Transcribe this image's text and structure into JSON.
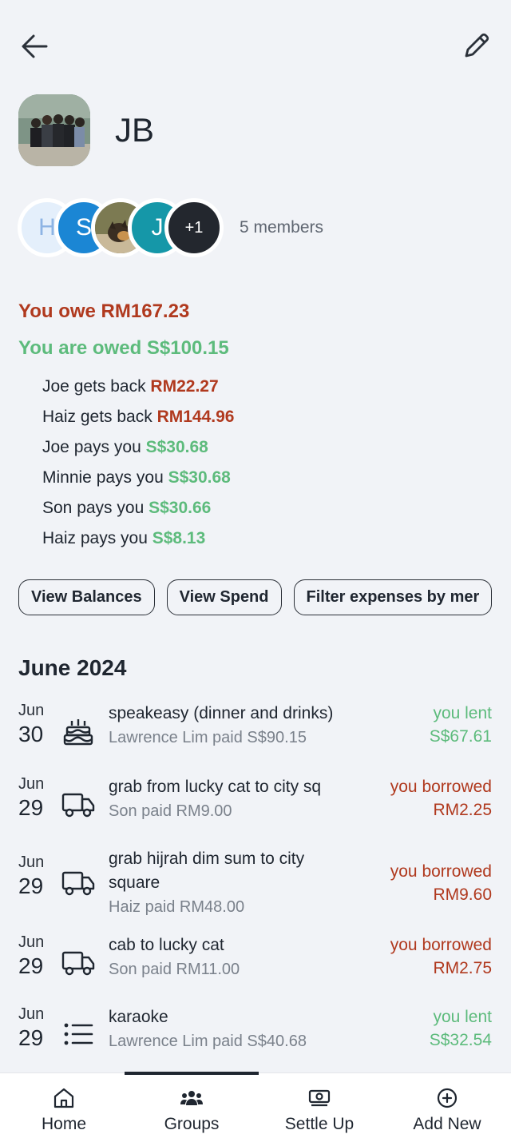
{
  "group": {
    "name": "JB",
    "members_label": "5 members",
    "member_initials": [
      "H",
      "S",
      "J"
    ],
    "more_members": "+1"
  },
  "summary": {
    "owe_text": "You owe RM167.23",
    "owed_text": "You are owed S$100.15"
  },
  "debts": [
    {
      "prefix": "Joe gets back ",
      "amount": "RM22.27",
      "kind": "red"
    },
    {
      "prefix": "Haiz gets back ",
      "amount": "RM144.96",
      "kind": "red"
    },
    {
      "prefix": "Joe pays you ",
      "amount": "S$30.68",
      "kind": "green"
    },
    {
      "prefix": "Minnie pays you ",
      "amount": "S$30.68",
      "kind": "green"
    },
    {
      "prefix": "Son pays you ",
      "amount": "S$30.66",
      "kind": "green"
    },
    {
      "prefix": "Haiz pays you ",
      "amount": "S$8.13",
      "kind": "green"
    }
  ],
  "chips": [
    "View Balances",
    "View Spend",
    "Filter expenses by mer"
  ],
  "month_header": "June 2024",
  "expenses": [
    {
      "month": "Jun",
      "day": "30",
      "icon": "cake-icon",
      "title": "speakeasy (dinner and drinks)",
      "subtitle": "Lawrence Lim paid S$90.15",
      "status": "you lent",
      "amount": "S$67.61",
      "kind": "lent"
    },
    {
      "month": "Jun",
      "day": "29",
      "icon": "truck-icon",
      "title": "grab from lucky cat to city sq",
      "subtitle": "Son paid RM9.00",
      "status": "you borrowed",
      "amount": "RM2.25",
      "kind": "borrowed"
    },
    {
      "month": "Jun",
      "day": "29",
      "icon": "truck-icon",
      "title": "grab hijrah dim sum to city square",
      "subtitle": "Haiz paid RM48.00",
      "status": "you borrowed",
      "amount": "RM9.60",
      "kind": "borrowed"
    },
    {
      "month": "Jun",
      "day": "29",
      "icon": "truck-icon",
      "title": "cab to lucky cat",
      "subtitle": "Son paid RM11.00",
      "status": "you borrowed",
      "amount": "RM2.75",
      "kind": "borrowed"
    },
    {
      "month": "Jun",
      "day": "29",
      "icon": "list-icon",
      "title": "karaoke",
      "subtitle": "Lawrence Lim paid S$40.68",
      "status": "you lent",
      "amount": "S$32.54",
      "kind": "lent"
    }
  ],
  "nav": {
    "home": "Home",
    "groups": "Groups",
    "settle": "Settle Up",
    "add": "Add New",
    "active": "groups"
  },
  "colors": {
    "owe_red": "#b0391e",
    "owed_green": "#5dbb7c",
    "background": "#f1f3f7"
  }
}
